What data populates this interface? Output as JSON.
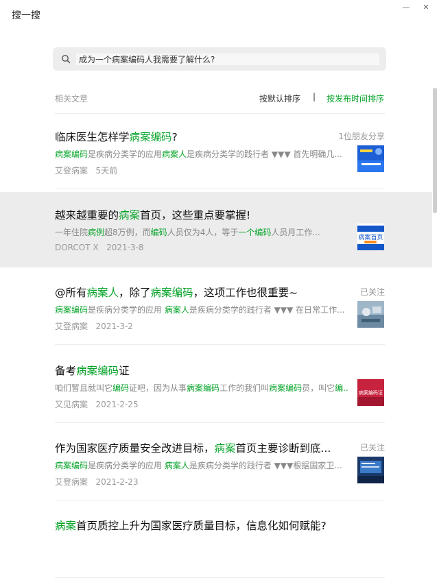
{
  "window": {
    "title": "搜一搜",
    "minimize_glyph": "—",
    "close_glyph": "✕"
  },
  "search": {
    "value": "成为一个病案编码人我需要了解什么?",
    "placeholder": ""
  },
  "results_header": {
    "label": "相关文章",
    "sort_default": "按默认排序",
    "divider": "|",
    "sort_time": "按发布时间排序"
  },
  "colors": {
    "highlight": "#07a42a",
    "hover_background": "#ececec"
  },
  "articles": [
    {
      "title": [
        [
          "临床医生怎样学",
          false
        ],
        [
          "病案编码",
          true
        ],
        [
          "?",
          false
        ]
      ],
      "side_info": "1位朋友分享",
      "snippet": [
        [
          "病案编码",
          true
        ],
        [
          "是疾病分类学的应用",
          false
        ],
        [
          "病案人",
          true
        ],
        [
          "是疾病分类学的践行者 ▼▼▼ 首先明确几...",
          false
        ]
      ],
      "source": "艾登病案",
      "date": "5天前",
      "thumbnail": "blue-poster-thumbnail"
    },
    {
      "title": [
        [
          "越来越重要的",
          false
        ],
        [
          "病案",
          true
        ],
        [
          "首页，这些重点要掌握!",
          false
        ]
      ],
      "side_info": "",
      "snippet": [
        [
          "一年住院",
          false
        ],
        [
          "病例",
          true
        ],
        [
          "超8万例，而",
          false
        ],
        [
          "编码",
          true
        ],
        [
          "人员仅为4人，等于",
          false
        ],
        [
          "一个编码",
          true
        ],
        [
          "人员月工作...",
          false
        ]
      ],
      "source": "DORCOT X",
      "date": "2021-3-8",
      "thumbnail": "homepage-banner-thumbnail",
      "thumbnail_text": "病案首页"
    },
    {
      "title": [
        [
          "@所有",
          false
        ],
        [
          "病案人",
          true
        ],
        [
          "，除了",
          false
        ],
        [
          "病案编码",
          true
        ],
        [
          "，这项工作也很重要~",
          false
        ]
      ],
      "side_info": "已关注",
      "snippet": [
        [
          "病案编码",
          true
        ],
        [
          "是疾病分类学的应用 ",
          false
        ],
        [
          "病案人",
          true
        ],
        [
          "是疾病分类学的践行者 ▼▼▼ 在日常工作...",
          false
        ]
      ],
      "source": "艾登病案",
      "date": "2021-3-2",
      "thumbnail": "office-photo-thumbnail"
    },
    {
      "title": [
        [
          "备考",
          false
        ],
        [
          "病案编码",
          true
        ],
        [
          "证",
          false
        ]
      ],
      "side_info": "",
      "snippet": [
        [
          "咱们暂且就叫它",
          false
        ],
        [
          "编码",
          true
        ],
        [
          "证吧，因为从事",
          false
        ],
        [
          "病案编码",
          true
        ],
        [
          "工作的我们叫",
          false
        ],
        [
          "病案编码",
          true
        ],
        [
          "员，叫它",
          false
        ],
        [
          "编...",
          true
        ]
      ],
      "source": "又见病案",
      "date": "2021-2-25",
      "thumbnail": "exam-poster-thumbnail",
      "thumbnail_text": "病案编码证"
    },
    {
      "title": [
        [
          "作为国家医疗质量安全改进目标，",
          false
        ],
        [
          "病案",
          true
        ],
        [
          "首页主要诊断到底...",
          false
        ]
      ],
      "side_info": "已关注",
      "snippet": [
        [
          "病案编码",
          true
        ],
        [
          "是疾病分类学的应用 ",
          false
        ],
        [
          "病案人",
          true
        ],
        [
          "是疾病分类学的践行者 ▼▼▼根据国家卫...",
          false
        ]
      ],
      "source": "艾登病案",
      "date": "2021-2-23",
      "thumbnail": "presentation-photo-thumbnail"
    },
    {
      "title": [
        [
          "病案",
          true
        ],
        [
          "首页质控上升为国家医疗质量目标，信息化如何赋能?",
          false
        ]
      ],
      "side_info": "",
      "snippet": [],
      "source": "",
      "date": "",
      "thumbnail": ""
    }
  ]
}
